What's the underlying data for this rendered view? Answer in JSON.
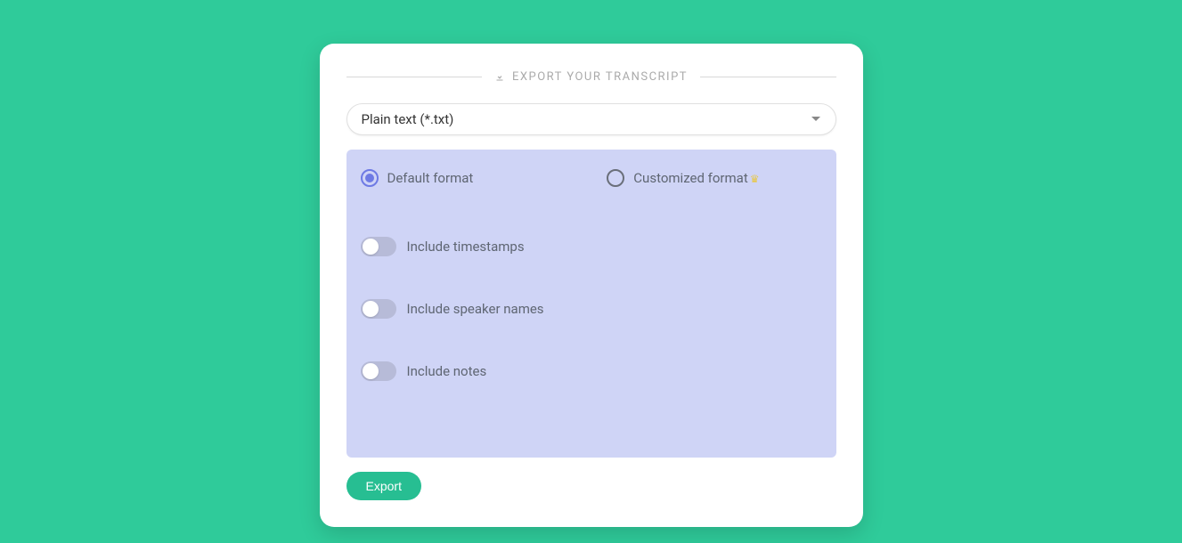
{
  "header": {
    "title": "EXPORT YOUR TRANSCRIPT"
  },
  "format_select": {
    "selected": "Plain text (*.txt)"
  },
  "radios": {
    "default_label": "Default format",
    "customized_label": "Customized format"
  },
  "toggles": {
    "timestamps": "Include timestamps",
    "speakers": "Include speaker names",
    "notes": "Include notes"
  },
  "actions": {
    "export": "Export"
  }
}
